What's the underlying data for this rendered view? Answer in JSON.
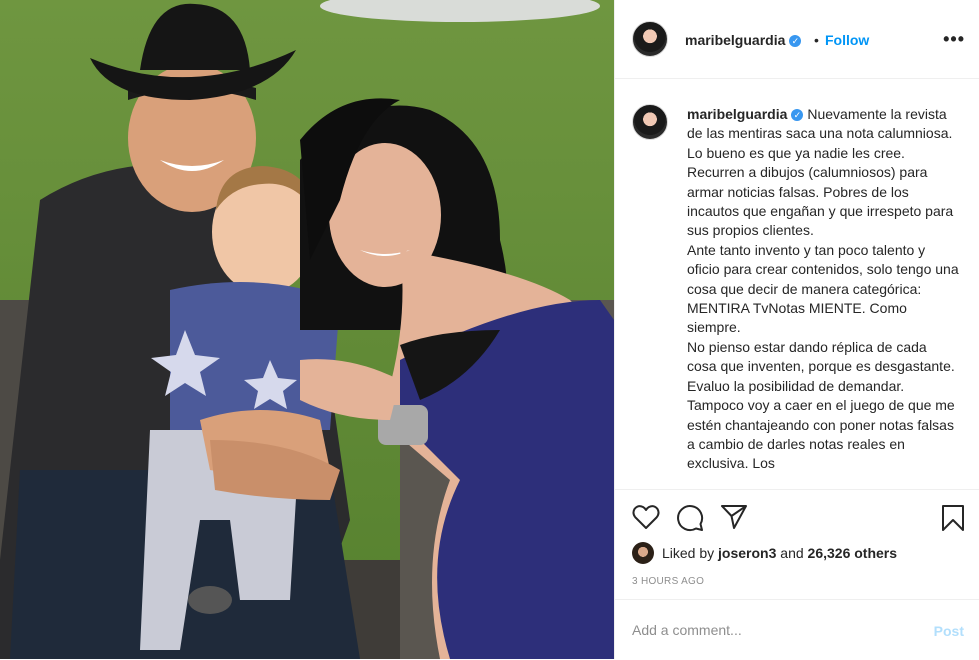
{
  "header": {
    "username": "maribelguardia",
    "verified_mark": "✓",
    "separator": "•",
    "follow_label": "Follow",
    "more_label": "•••"
  },
  "caption": {
    "username": "maribelguardia",
    "text": "Nuevamente la revista de las mentiras saca una nota calumniosa. Lo bueno es que ya nadie les cree. Recurren a dibujos (calumniosos) para armar noticias falsas. Pobres de los incautos que engañan y que irrespeto para sus propios clientes.\nAnte tanto invento y tan poco talento y oficio para crear contenidos, solo tengo una cosa que decir de manera categórica: MENTIRA TvNotas MIENTE. Como siempre.\nNo pienso estar dando réplica de cada cosa que inventen, porque es desgastante. Evaluo la posibilidad de demandar. Tampoco voy a caer en el juego de que me estén chantajeando con poner notas falsas a cambio de darles notas reales en exclusiva. Los"
  },
  "actions": {
    "icons": [
      "heart-icon",
      "comment-icon",
      "share-icon",
      "bookmark-icon"
    ]
  },
  "likes": {
    "prefix": "Liked by ",
    "user": "joseron3",
    "middle": " and ",
    "count": "26,326 others"
  },
  "time": "3 HOURS AGO",
  "comment": {
    "placeholder": "Add a comment...",
    "post_label": "Post"
  },
  "colors": {
    "accent": "#0095f6",
    "post_disabled": "#b2dffc",
    "verified": "#3897f0"
  }
}
